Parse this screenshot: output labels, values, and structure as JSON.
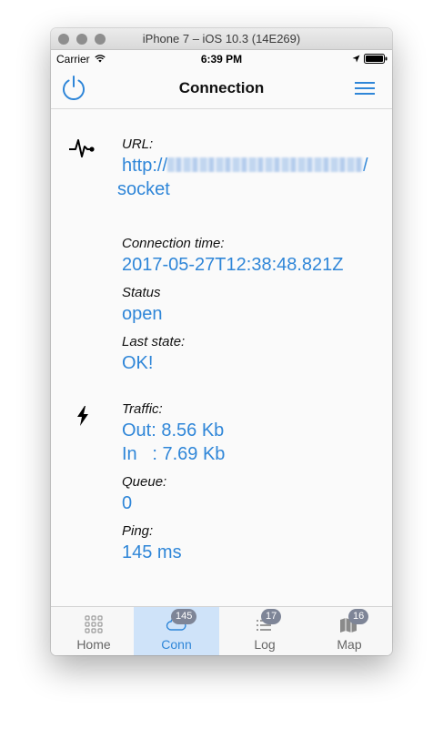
{
  "window": {
    "title": "iPhone 7 – iOS 10.3 (14E269)"
  },
  "statusbar": {
    "carrier": "Carrier",
    "time": "6:39 PM"
  },
  "navbar": {
    "title": "Connection"
  },
  "connection": {
    "url_label": "URL:",
    "url_prefix": "http://",
    "url_suffix": "/",
    "url_tail": "socket",
    "time_label": "Connection time:",
    "time_value": "2017-05-27T12:38:48.821Z",
    "status_label": "Status",
    "status_value": "open",
    "last_state_label": "Last state:",
    "last_state_value": "OK!"
  },
  "traffic": {
    "label": "Traffic:",
    "out": "Out: 8.56 Kb",
    "in": "In   : 7.69 Kb",
    "queue_label": "Queue:",
    "queue_value": "0",
    "ping_label": "Ping:",
    "ping_value": "145 ms"
  },
  "tabs": [
    {
      "label": "Home",
      "badge": ""
    },
    {
      "label": "Conn",
      "badge": "145"
    },
    {
      "label": "Log",
      "badge": "17"
    },
    {
      "label": "Map",
      "badge": "16"
    }
  ],
  "colors": {
    "accent": "#2f86d8",
    "active_tab_bg": "#cfe3f9",
    "badge": "#7e8597"
  }
}
